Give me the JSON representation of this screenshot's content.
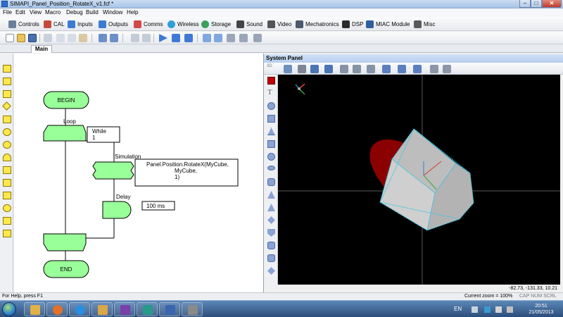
{
  "window": {
    "title": "SIMAPI_Panel_Position_RotateX_v1.fcf *",
    "minimize": "–",
    "maximize": "□",
    "close": "✕"
  },
  "menu": [
    "File",
    "Edit",
    "View",
    "Macro",
    "Debug",
    "Build",
    "Window",
    "Help"
  ],
  "component_toolbar": [
    {
      "label": "Controls",
      "icon": "controls-icon",
      "color": "#6a7f9a"
    },
    {
      "label": "CAL",
      "icon": "cal-icon",
      "color": "#c44b3a"
    },
    {
      "label": "Inputs",
      "icon": "inputs-icon",
      "color": "#3b7bd4"
    },
    {
      "label": "Outputs",
      "icon": "outputs-icon",
      "color": "#3b7bd4"
    },
    {
      "label": "Comms",
      "icon": "comms-icon",
      "color": "#d14a4a"
    },
    {
      "label": "Wireless",
      "icon": "wireless-icon",
      "color": "#2f9fd9"
    },
    {
      "label": "Storage",
      "icon": "storage-icon",
      "color": "#3aa05a"
    },
    {
      "label": "Sound",
      "icon": "sound-icon",
      "color": "#444444"
    },
    {
      "label": "Video",
      "icon": "video-icon",
      "color": "#555555"
    },
    {
      "label": "Mechatronics",
      "icon": "mechatronics-icon",
      "color": "#4b5a6a"
    },
    {
      "label": "DSP",
      "icon": "dsp-icon",
      "color": "#2a2a2a"
    },
    {
      "label": "MIAC Module",
      "icon": "miac-module-icon",
      "color": "#2f5f9f"
    },
    {
      "label": "Misc",
      "icon": "misc-icon",
      "color": "#5a5a5a"
    }
  ],
  "tabs": {
    "main": "Main"
  },
  "flowchart": {
    "begin": "BEGIN",
    "loop_label": "Loop",
    "loop_condition": [
      "While",
      "1"
    ],
    "sim_label": "Simulation",
    "sim_call": [
      "Panel.Position.RotateX(MyCube,",
      "MyCube,",
      "1)"
    ],
    "delay_label": "Delay",
    "delay_value": "100 ms",
    "end": "END",
    "colors": {
      "fill": "#99ff99",
      "stroke": "#000000",
      "line": "#000000"
    }
  },
  "system_panel": {
    "title": "System Panel",
    "dim_label": "3D",
    "coordinates": "-82.73, -131.33, 10.21",
    "colors": {
      "background": "#000000",
      "ellipse": "#8b0000",
      "cube_face": "#c0c0c0",
      "cube_edge": "#39c5e6",
      "axis_x": "#d43a2a",
      "axis_y": "#3aa53a",
      "axis_z": "#3a7ad4"
    }
  },
  "status": {
    "help": "For Help, press F1",
    "zoom": "Current zoom = 100%",
    "keys": "CAP NUM SCRL"
  },
  "taskbar": {
    "language": "EN",
    "time": "20:51",
    "date": "21/05/2013"
  }
}
